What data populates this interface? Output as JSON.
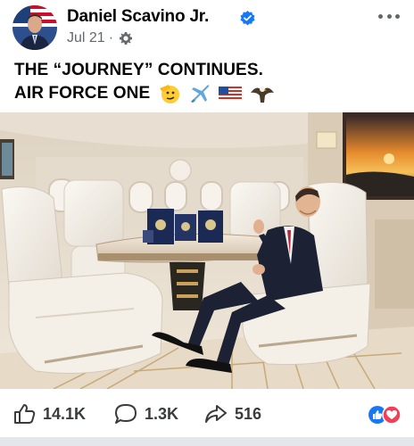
{
  "post": {
    "author": "Daniel Scavino Jr.",
    "verified_icon": "verified-badge-icon",
    "date": "Jul 21",
    "separator": "·",
    "audience_icon": "gear-icon",
    "caption_line1": "THE “JOURNEY” CONTINUES.",
    "caption_line2": "AIR FORCE ONE",
    "caption_emojis": [
      "saluting-face-icon",
      "airplane-icon",
      "us-flag-icon",
      "eagle-icon"
    ]
  },
  "engagement": {
    "likes": "14.1K",
    "comments": "1.3K",
    "shares": "516"
  },
  "colors": {
    "verified_blue": "#1877f2",
    "meta_gray": "#65676b",
    "like_blue": "#1877f2",
    "love_red": "#f33e58"
  }
}
